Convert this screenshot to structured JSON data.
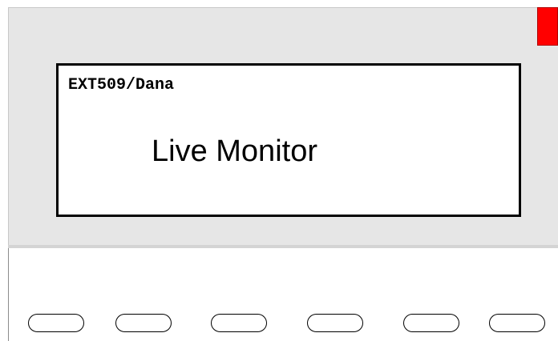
{
  "display": {
    "header": "EXT509/Dana",
    "main_text": "Live Monitor"
  },
  "indicator": {
    "color": "#ff0000"
  },
  "softkeys": [
    {
      "label": ""
    },
    {
      "label": ""
    },
    {
      "label": ""
    },
    {
      "label": ""
    },
    {
      "label": ""
    },
    {
      "label": ""
    }
  ]
}
